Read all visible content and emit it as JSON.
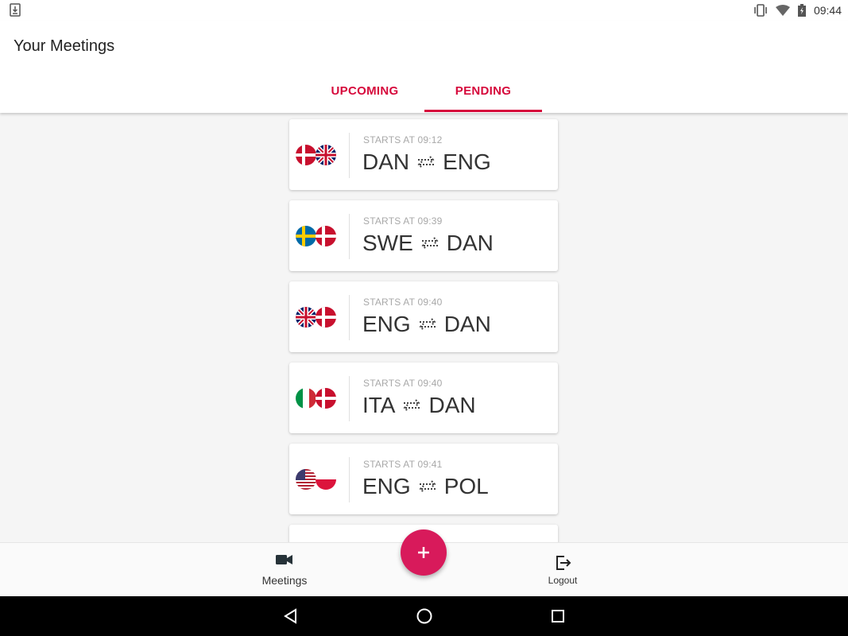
{
  "status_bar": {
    "time": "09:44"
  },
  "app_bar": {
    "title": "Your Meetings",
    "tabs": [
      {
        "label": "UPCOMING",
        "selected": false
      },
      {
        "label": "PENDING",
        "selected": true
      }
    ],
    "accent_color": "#d6083b"
  },
  "meetings": [
    {
      "starts": "STARTS AT 09:12",
      "from": "DAN",
      "to": "ENG",
      "flag_from": "denmark",
      "flag_to": "united-kingdom"
    },
    {
      "starts": "STARTS AT 09:39",
      "from": "SWE",
      "to": "DAN",
      "flag_from": "sweden",
      "flag_to": "denmark"
    },
    {
      "starts": "STARTS AT 09:40",
      "from": "ENG",
      "to": "DAN",
      "flag_from": "united-kingdom",
      "flag_to": "denmark"
    },
    {
      "starts": "STARTS AT 09:40",
      "from": "ITA",
      "to": "DAN",
      "flag_from": "italy",
      "flag_to": "denmark"
    },
    {
      "starts": "STARTS AT 09:41",
      "from": "ENG",
      "to": "POL",
      "flag_from": "united-states",
      "flag_to": "poland"
    }
  ],
  "bottom_nav": {
    "meetings_label": "Meetings",
    "logout_label": "Logout",
    "meetings_icon": "video-camera-icon",
    "logout_icon": "logout-icon"
  },
  "fab": {
    "icon": "plus-icon",
    "color": "#d81a5b"
  },
  "system_nav": {
    "back_icon": "back-triangle-icon",
    "home_icon": "home-circle-icon",
    "recent_icon": "recent-square-icon"
  }
}
